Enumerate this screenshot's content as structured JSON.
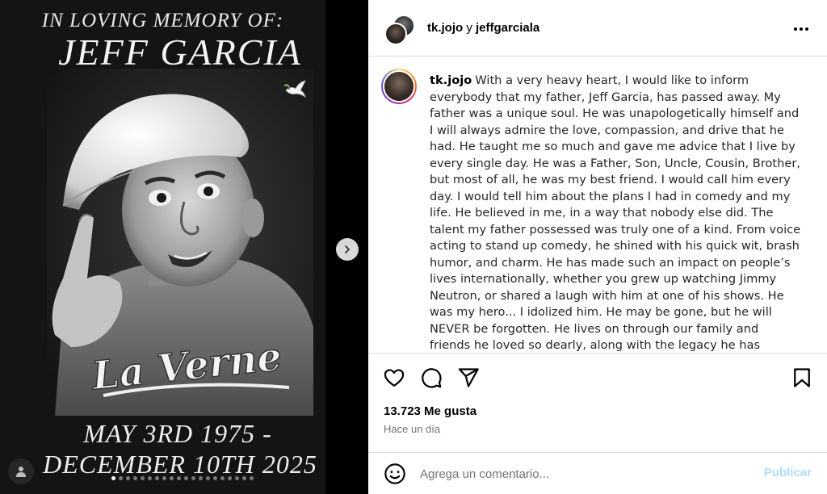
{
  "media": {
    "title_line": "IN LOVING MEMORY OF:",
    "name_line": "JEFF GARCIA",
    "shirt_text": "La Verne",
    "date_line_1": "MAY 3RD 1975 -",
    "date_line_2": "DECEMBER 10TH 2025",
    "slide_count": 20,
    "active_slide": 1
  },
  "header": {
    "user_1": "tk.jojo",
    "joiner": "y",
    "user_2": "jeffgarciala"
  },
  "caption": {
    "username": "tk.jojo",
    "text": "With a very heavy heart, I would like to inform everybody that my father, Jeff Garcia, has passed away. My father was a unique soul. He was unapologetically himself and I will always admire the love, compassion, and drive that he had. He taught me so much and gave me advice that I live by every single day. He was a Father, Son, Uncle, Cousin, Brother, but most of all, he was my best friend. I would call him every day. I would tell him about the plans I had in comedy and my life. He believed in me, in a way that nobody else did. The talent my father possessed was truly one of a kind. From voice acting to stand up comedy, he shined with his quick wit, brash humor, and charm. He has made such an impact on people’s lives internationally, whether you grew up watching Jimmy Neutron, or shared a laugh with him at one of his shows. He was my hero... I idolized him. He may be gone, but he will NEVER be forgotten. He lives on through our family and friends he loved so dearly, along with the legacy he has created. I know you’re in heaven smiling down and you’re in"
  },
  "engagement": {
    "likes": "13.723 Me gusta",
    "time_ago": "Hace un día"
  },
  "comment": {
    "placeholder": "Agrega un comentario...",
    "publish_label": "Publicar"
  },
  "icons": {
    "more": "more-options-icon",
    "like": "heart-icon",
    "comment": "comment-icon",
    "share": "share-icon",
    "save": "bookmark-icon",
    "emoji": "emoji-icon",
    "next": "chevron-right-icon",
    "dove": "dove-icon",
    "profile": "user-icon"
  },
  "colors": {
    "publish_disabled": "#b3dbff",
    "muted_text": "#737373",
    "border": "#dbdbdb"
  }
}
